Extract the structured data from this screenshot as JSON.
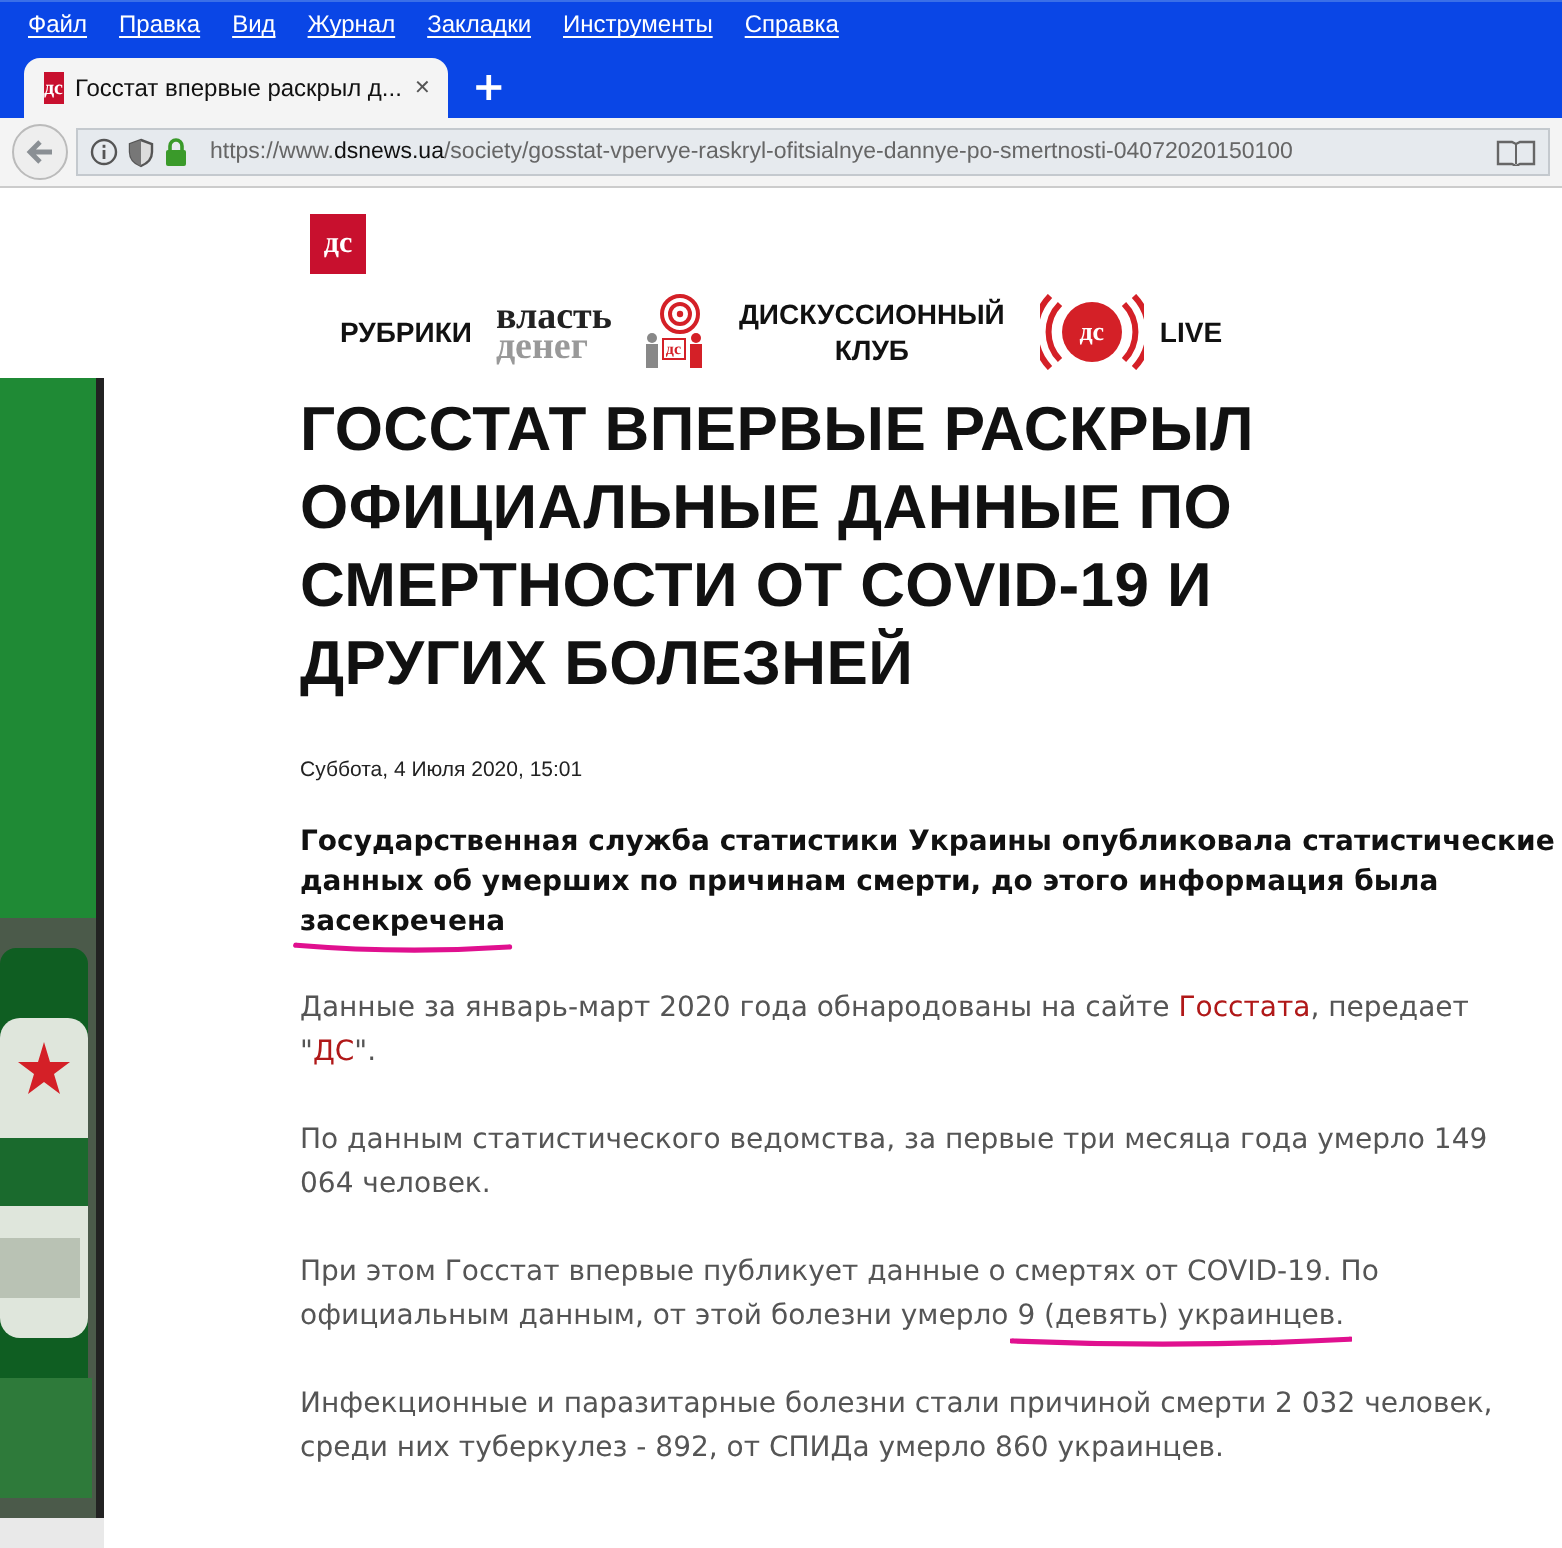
{
  "menu_bar": {
    "items": [
      {
        "label": "Файл"
      },
      {
        "label": "Правка"
      },
      {
        "label": "Вид"
      },
      {
        "label": "Журнал"
      },
      {
        "label": "Закладки"
      },
      {
        "label": "Инструменты"
      },
      {
        "label": "Справка"
      }
    ]
  },
  "tabs": [
    {
      "favicon": "дс",
      "title": "Госстат впервые раскрыл д...",
      "close": "✕",
      "selected": true
    }
  ],
  "new_tab": "+",
  "address_bar": {
    "url_prefix": "https://www.",
    "url_domain": "dsnews.ua",
    "url_path": "/society/gosstat-vpervye-raskryl-ofitsialnye-dannye-po-smertnosti-04072020150100"
  },
  "site": {
    "logo": "дс",
    "nav": [
      {
        "kind": "text",
        "label": "РУБРИКИ"
      },
      {
        "kind": "vlast",
        "line1": "власть",
        "line2": "денег"
      },
      {
        "kind": "club",
        "badge": "дс",
        "label": "ДИСКУССИОННЫЙ КЛУБ"
      },
      {
        "kind": "live",
        "badge": "дс",
        "label": "LIVE"
      }
    ]
  },
  "article": {
    "title": "ГОССТАТ ВПЕРВЫЕ РАСКРЫЛ ОФИЦИАЛЬНЫЕ ДАННЫЕ ПО СМЕРТНОСТИ ОТ COVID-19 И ДРУГИХ БОЛЕЗНЕЙ",
    "date": "Суббота, 4 Июля 2020, 15:01",
    "lead": {
      "text": "Государственная служба статистики Украины опубликовала статистические данных об умерших по причинам смерти, до этого информация была",
      "marked": "засекречена"
    },
    "paragraphs": [
      {
        "parts": [
          {
            "text": "Данные за январь-март 2020 года обнародованы на сайте "
          },
          {
            "text": "Госстата",
            "link": true
          },
          {
            "text": ", передает \""
          },
          {
            "text": "ДС",
            "link": true
          },
          {
            "text": "\"."
          }
        ]
      },
      {
        "parts": [
          {
            "text": "По данным статистического ведомства, за первые три месяца года умерло 149 064 человек."
          }
        ]
      },
      {
        "parts": [
          {
            "text": "При этом Госстат впервые публикует данные о смертях от COVID-19. По официальным данным, от этой болезни умерло "
          },
          {
            "text": "9 (девять) украинцев.",
            "marked": true
          }
        ]
      },
      {
        "parts": [
          {
            "text": "Инфекционные и паразитарные болезни стали причиной смерти 2 032 человек, среди них туберкулез - 892, от СПИДа умерло 860 украинцев."
          }
        ]
      }
    ]
  }
}
